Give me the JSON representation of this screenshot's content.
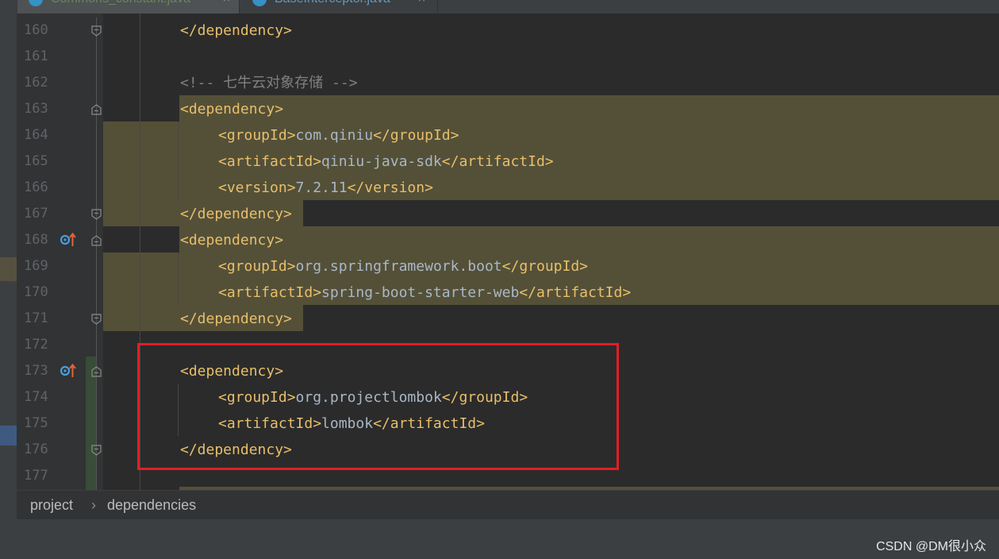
{
  "tabs": [
    {
      "name": "Commons_constant.java",
      "close": "×"
    },
    {
      "name": "BaseInterceptor.java",
      "close": "×"
    }
  ],
  "gutter": {
    "line_numbers": [
      "160",
      "161",
      "162",
      "163",
      "164",
      "165",
      "166",
      "167",
      "168",
      "169",
      "170",
      "171",
      "172",
      "173",
      "174",
      "175",
      "176",
      "177"
    ]
  },
  "code": {
    "l160": {
      "tag": "</dependency>"
    },
    "l162": {
      "comment": "<!-- 七牛云对象存储 -->"
    },
    "l163": {
      "tag": "<dependency>"
    },
    "l164": {
      "open": "<groupId>",
      "value": "com.qiniu",
      "close": "</groupId>"
    },
    "l165": {
      "open": "<artifactId>",
      "value": "qiniu-java-sdk",
      "close": "</artifactId>"
    },
    "l166": {
      "open": "<version>",
      "value": "7.2.11",
      "close": "</version>"
    },
    "l167": {
      "tag": "</dependency>"
    },
    "l168": {
      "tag": "<dependency>"
    },
    "l169": {
      "open": "<groupId>",
      "value": "org.springframework.boot",
      "close": "</groupId>"
    },
    "l170": {
      "open": "<artifactId>",
      "value": "spring-boot-starter-web",
      "close": "</artifactId>"
    },
    "l171": {
      "tag": "</dependency>"
    },
    "l173": {
      "tag": "<dependency>"
    },
    "l174": {
      "open": "<groupId>",
      "value": "org.projectlombok",
      "close": "</groupId>"
    },
    "l175": {
      "open": "<artifactId>",
      "value": "lombok",
      "close": "</artifactId>"
    },
    "l176": {
      "tag": "</dependency>"
    }
  },
  "breadcrumb": {
    "item1": "project",
    "sep": "›",
    "item2": "dependencies"
  },
  "watermark": "CSDN @DM很小众",
  "colors": {
    "tag": "#e8bf6a",
    "text": "#a9b7c6",
    "comment": "#808080",
    "highlight": "#545038",
    "annotation": "#e01f25",
    "line_number": "#606366"
  },
  "icons": [
    "java-class-icon",
    "close-icon",
    "fold-marker-icon",
    "maven-override-icon"
  ]
}
